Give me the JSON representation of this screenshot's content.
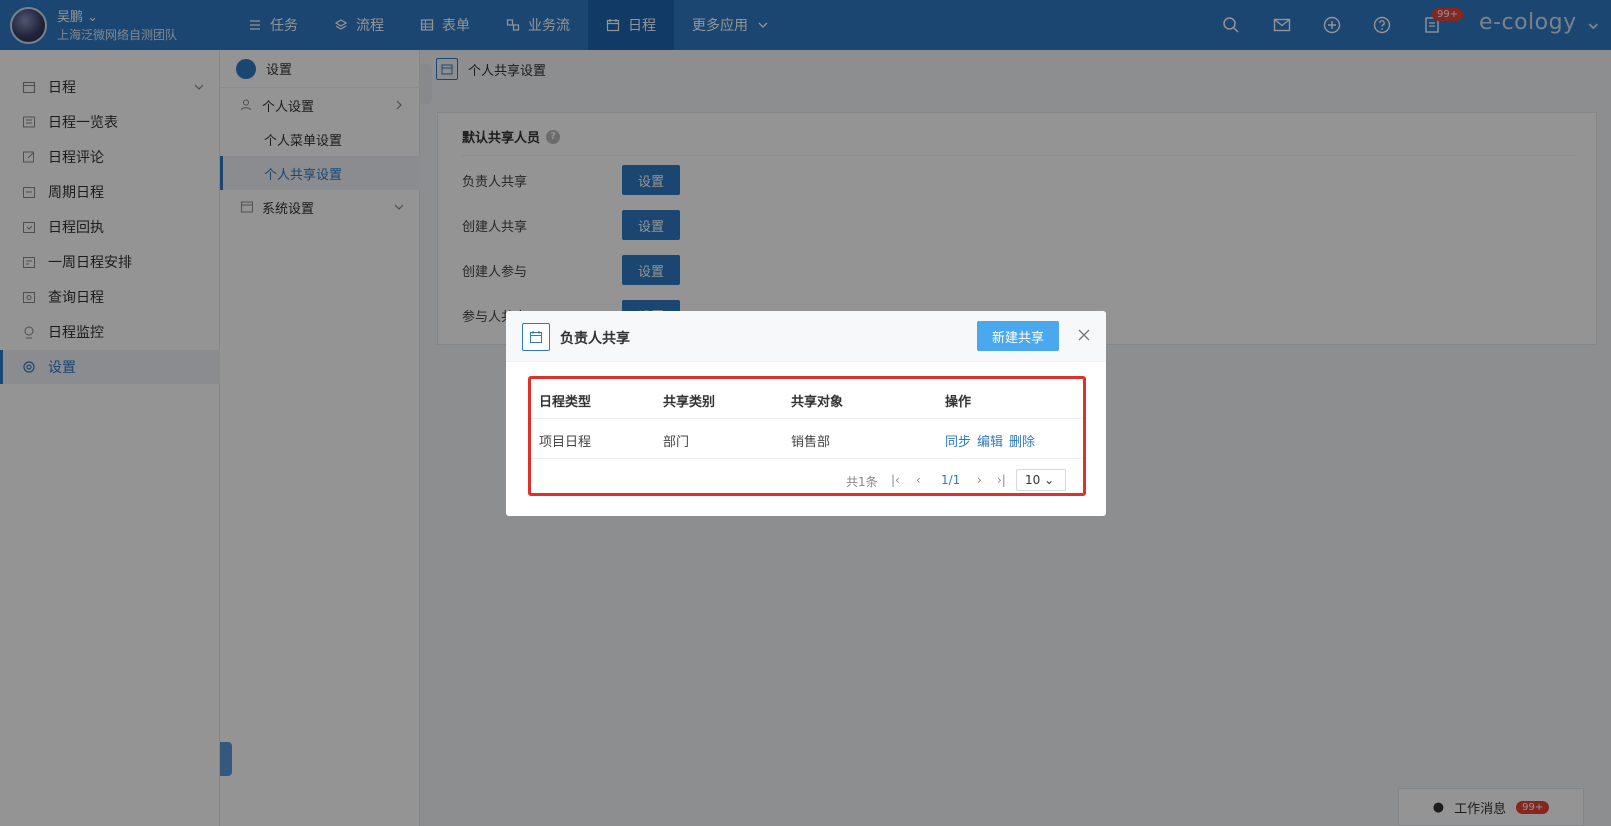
{
  "user": {
    "name": "吴鹏",
    "org": "上海泛微网络自测团队"
  },
  "nav": [
    {
      "label": "任务",
      "icon": "list-icon"
    },
    {
      "label": "流程",
      "icon": "layers-icon"
    },
    {
      "label": "表单",
      "icon": "table-icon"
    },
    {
      "label": "业务流",
      "icon": "flow-icon"
    },
    {
      "label": "日程",
      "icon": "calendar-icon",
      "active": true
    },
    {
      "label": "更多应用",
      "icon": "chevron-down-icon"
    }
  ],
  "topbar": {
    "badge": "99+",
    "brand": "e-cology"
  },
  "sidebar": [
    {
      "label": "日程",
      "icon": "calendar-icon"
    },
    {
      "label": "日程一览表",
      "icon": "list-icon"
    },
    {
      "label": "日程评论",
      "icon": "edit-icon"
    },
    {
      "label": "周期日程",
      "icon": "cycle-icon"
    },
    {
      "label": "日程回执",
      "icon": "receipt-icon"
    },
    {
      "label": "一周日程安排",
      "icon": "week-icon"
    },
    {
      "label": "查询日程",
      "icon": "search-icon"
    },
    {
      "label": "日程监控",
      "icon": "monitor-icon"
    },
    {
      "label": "设置",
      "icon": "gear-icon",
      "active": true
    }
  ],
  "subnav": {
    "head": "设置",
    "items": [
      "个人设置",
      "个人菜单设置",
      "个人共享设置",
      "系统设置"
    ]
  },
  "page": {
    "breadcrumb": "个人共享设置",
    "section_title": "默认共享人员",
    "help": "?",
    "rows": [
      {
        "label": "负责人共享",
        "button": "设置"
      },
      {
        "label": "创建人共享",
        "button": "设置"
      },
      {
        "label": "创建人参与",
        "button": "设置"
      },
      {
        "label": "参与人共享",
        "button": "设置"
      }
    ]
  },
  "modal": {
    "title": "负责人共享",
    "new_button": "新建共享",
    "columns": [
      "日程类型",
      "共享类别",
      "共享对象",
      "操作"
    ],
    "rows": [
      {
        "type": "项目日程",
        "category": "部门",
        "target": "销售部",
        "actions": [
          "同步",
          "编辑",
          "删除"
        ]
      }
    ],
    "pager": {
      "total": "共1条",
      "page": "1/1",
      "size": "10"
    }
  },
  "messages": {
    "label": "工作消息",
    "badge": "99+"
  }
}
